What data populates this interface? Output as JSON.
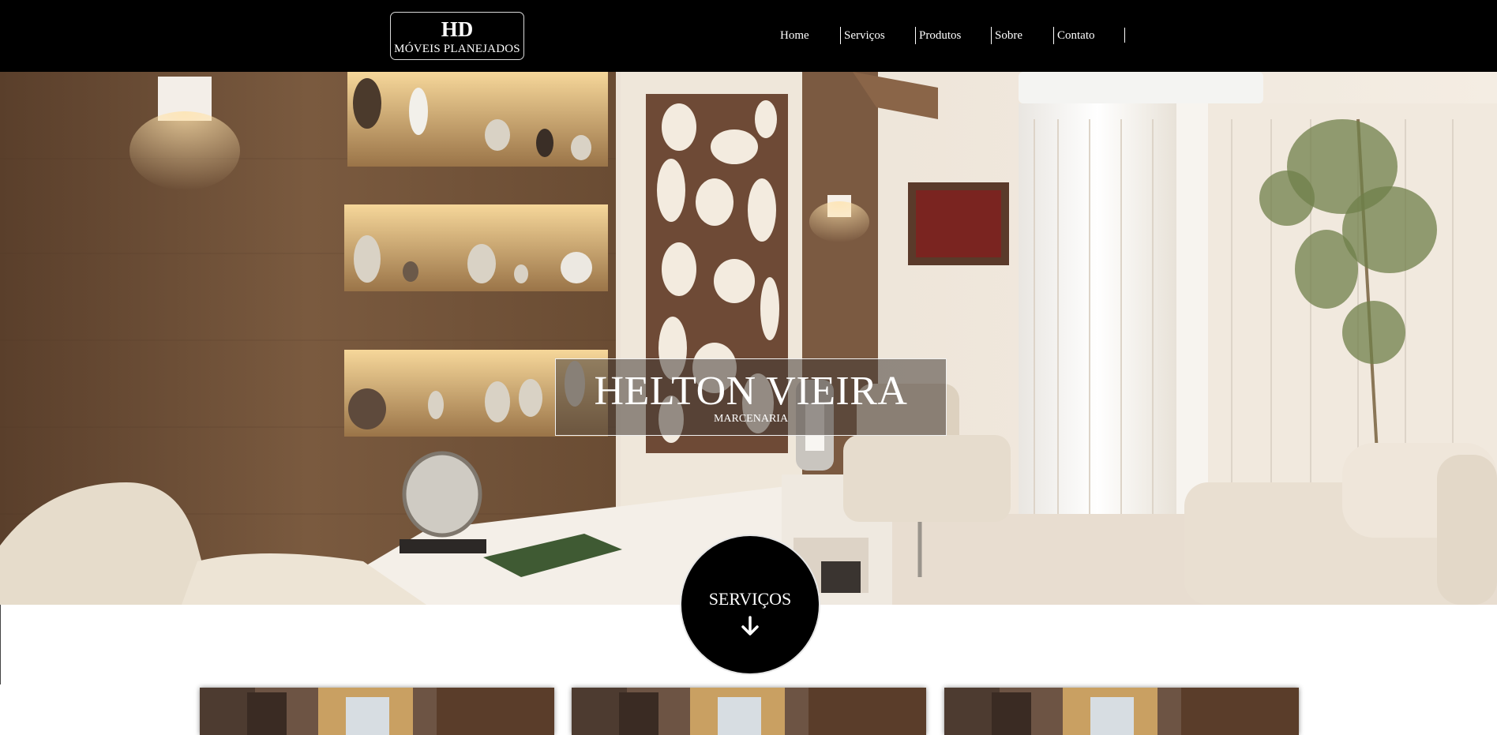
{
  "header": {
    "logo_title": "HD",
    "logo_subtitle": "MÓVEIS PLANEJADOS",
    "nav": [
      "Home",
      "Serviços",
      "Produtos",
      "Sobre",
      "Contato"
    ]
  },
  "hero": {
    "title": "HELTON VIEIRA",
    "subtitle": "MARCENARIA"
  },
  "services_button": {
    "label": "SERVIÇOS",
    "icon": "arrow-down-icon"
  },
  "colors": {
    "header_bg": "#000000",
    "text_on_dark": "#ffffff",
    "wood": "#6b4e36",
    "cream": "#e9dcc8"
  }
}
